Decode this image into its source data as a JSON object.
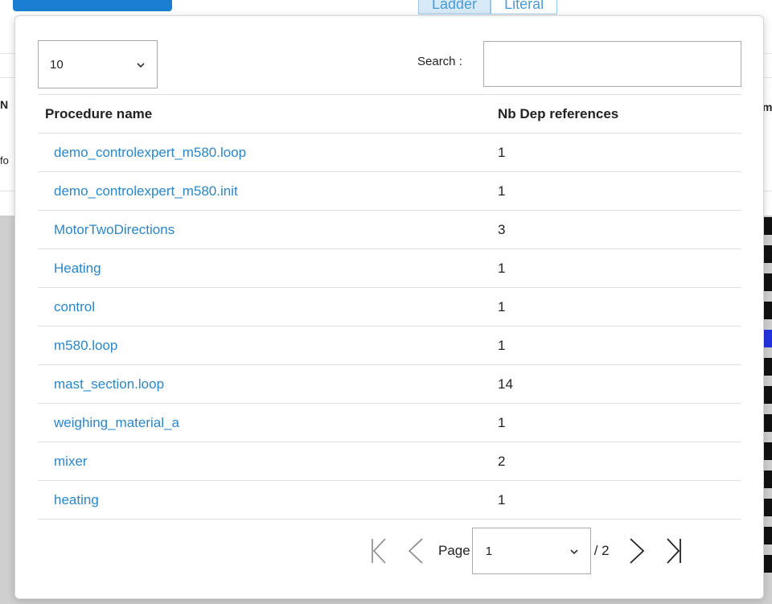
{
  "background": {
    "tabs": [
      {
        "label": "Ladder",
        "active": true
      },
      {
        "label": "Literal",
        "active": false
      }
    ],
    "left_edge_header": "N",
    "left_edge_cell": "fo",
    "right_edge_header": "m"
  },
  "modal": {
    "page_size": {
      "value": "10"
    },
    "search": {
      "label": "Search :",
      "value": "",
      "placeholder": ""
    },
    "table": {
      "columns": [
        "Procedure name",
        "Nb Dep references"
      ],
      "rows": [
        {
          "name": "demo_controlexpert_m580.loop",
          "refs": "1"
        },
        {
          "name": "demo_controlexpert_m580.init",
          "refs": "1"
        },
        {
          "name": "MotorTwoDirections",
          "refs": "3"
        },
        {
          "name": "Heating",
          "refs": "1"
        },
        {
          "name": "control",
          "refs": "1"
        },
        {
          "name": "m580.loop",
          "refs": "1"
        },
        {
          "name": "mast_section.loop",
          "refs": "14"
        },
        {
          "name": "weighing_material_a",
          "refs": "1"
        },
        {
          "name": "mixer",
          "refs": "2"
        },
        {
          "name": "heating",
          "refs": "1"
        }
      ]
    },
    "pagination": {
      "page_label": "Page",
      "current_page": "1",
      "total": "/ 2"
    }
  },
  "colors": {
    "link": "#2a86c9",
    "accent_blue": "#1a7fd0"
  }
}
